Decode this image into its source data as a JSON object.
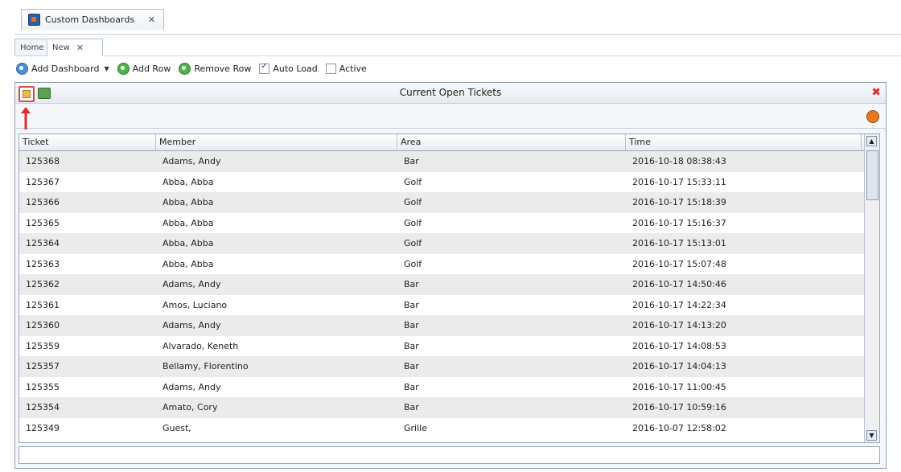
{
  "doc_tab": {
    "label": "Custom Dashboards",
    "close": "✕"
  },
  "sub_tabs": [
    {
      "label": "Home"
    },
    {
      "label": "New",
      "close": "✕"
    }
  ],
  "toolbar": {
    "add_dashboard": "Add Dashboard",
    "add_row": "Add Row",
    "remove_row": "Remove Row",
    "auto_load": {
      "label": "Auto Load",
      "checked": true
    },
    "active": {
      "label": "Active",
      "checked": false
    }
  },
  "panel": {
    "title": "Current Open Tickets"
  },
  "grid": {
    "columns": [
      "Ticket",
      "Member",
      "Area",
      "Time"
    ],
    "rows": [
      [
        "125368",
        "Adams, Andy",
        "Bar",
        "2016-10-18 08:38:43"
      ],
      [
        "125367",
        "Abba, Abba",
        "Golf",
        "2016-10-17 15:33:11"
      ],
      [
        "125366",
        "Abba, Abba",
        "Golf",
        "2016-10-17 15:18:39"
      ],
      [
        "125365",
        "Abba, Abba",
        "Golf",
        "2016-10-17 15:16:37"
      ],
      [
        "125364",
        "Abba, Abba",
        "Golf",
        "2016-10-17 15:13:01"
      ],
      [
        "125363",
        "Abba, Abba",
        "Golf",
        "2016-10-17 15:07:48"
      ],
      [
        "125362",
        "Adams, Andy",
        "Bar",
        "2016-10-17 14:50:46"
      ],
      [
        "125361",
        "Amos, Luciano",
        "Bar",
        "2016-10-17 14:22:34"
      ],
      [
        "125360",
        "Adams, Andy",
        "Bar",
        "2016-10-17 14:13:20"
      ],
      [
        "125359",
        "Alvarado, Keneth",
        "Bar",
        "2016-10-17 14:08:53"
      ],
      [
        "125357",
        "Bellamy, Florentino",
        "Bar",
        "2016-10-17 14:04:13"
      ],
      [
        "125355",
        "Adams, Andy",
        "Bar",
        "2016-10-17 11:00:45"
      ],
      [
        "125354",
        "Amato, Cory",
        "Bar",
        "2016-10-17 10:59:16"
      ],
      [
        "125349",
        "Guest,",
        "Grille",
        "2016-10-07 12:58:02"
      ]
    ]
  }
}
